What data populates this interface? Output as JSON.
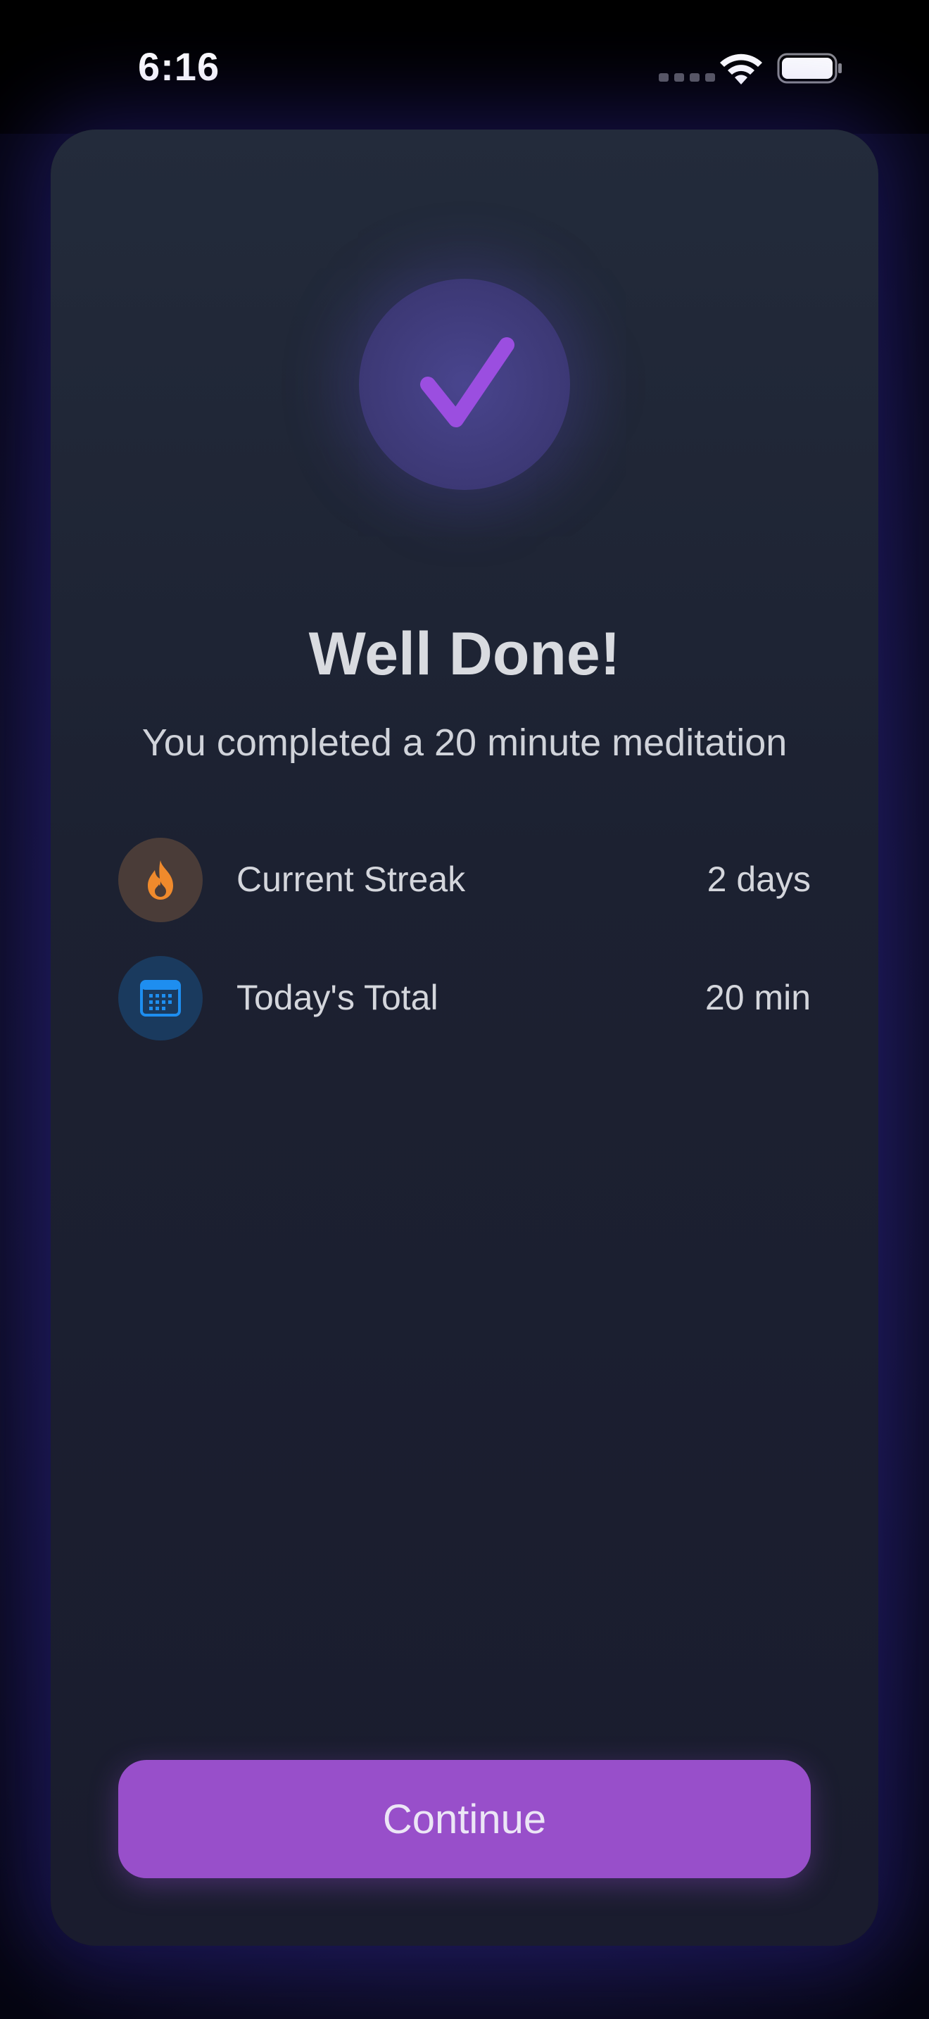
{
  "status_bar": {
    "time": "6:16"
  },
  "icons": {
    "status": [
      "cellular-dots-icon",
      "wifi-icon",
      "battery-icon"
    ],
    "hero": "checkmark-icon",
    "streak": "flame-icon",
    "total": "calendar-icon"
  },
  "colors": {
    "accent_purple": "#984fca",
    "check_purple": "#9b4ee0",
    "flame_orange": "#f08a2c",
    "calendar_blue": "#1e8ef0"
  },
  "completion": {
    "title": "Well Done!",
    "subtitle": "You completed a 20 minute meditation"
  },
  "stats": [
    {
      "label": "Current Streak",
      "value": "2 days"
    },
    {
      "label": "Today's Total",
      "value": "20 min"
    }
  ],
  "actions": {
    "continue_label": "Continue"
  }
}
